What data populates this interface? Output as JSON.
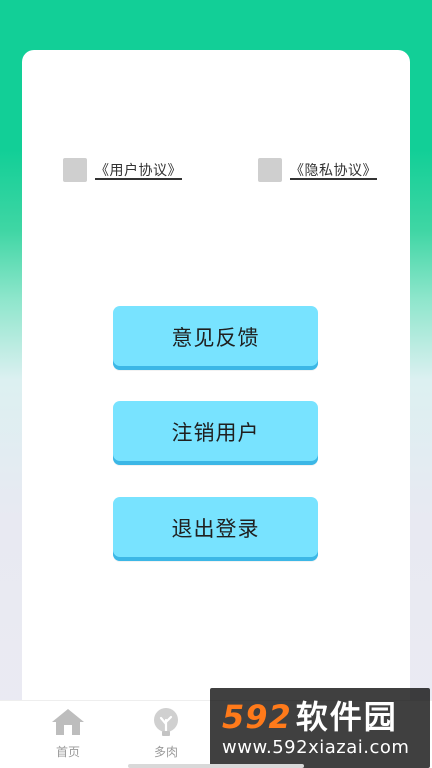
{
  "agreements": {
    "user": {
      "label": "《用户协议》",
      "checked": false
    },
    "privacy": {
      "label": "《隐私协议》",
      "checked": false
    }
  },
  "actions": {
    "feedback": "意见反馈",
    "delete_account": "注销用户",
    "logout": "退出登录"
  },
  "tabbar": {
    "home": {
      "label": "首页",
      "icon": "house-icon"
    },
    "succulent": {
      "label": "多肉",
      "icon": "plant-icon"
    }
  },
  "watermark": {
    "number": "592",
    "name": "软件园",
    "url": "www.592xiazai.com"
  },
  "colors": {
    "header_green": "#12cf97",
    "button_fill": "#78e3ff",
    "button_shadow": "#3cb7e6",
    "watermark_orange": "#ff7a1a"
  }
}
